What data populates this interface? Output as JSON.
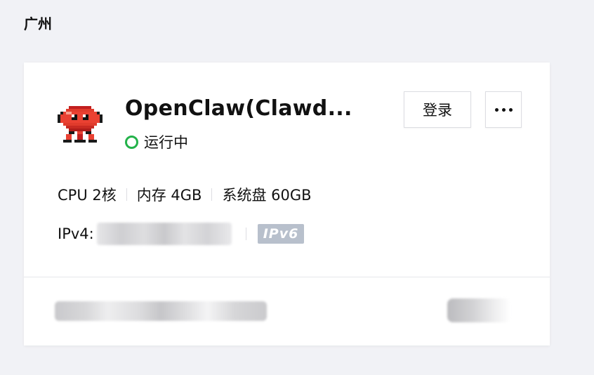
{
  "region": {
    "title": "广州"
  },
  "instance": {
    "name": "OpenClaw(Clawd...",
    "status": "运行中",
    "status_color": "#23b24a",
    "logo_icon": "pixel-crab-mascot-icon"
  },
  "actions": {
    "login_label": "登录",
    "more_icon": "more-horizontal-icon"
  },
  "specs": {
    "cpu": "CPU 2核",
    "memory": "内存 4GB",
    "disk": "系统盘 60GB"
  },
  "network": {
    "ipv4_label": "IPv4:",
    "ipv6_badge": "IPv6"
  }
}
